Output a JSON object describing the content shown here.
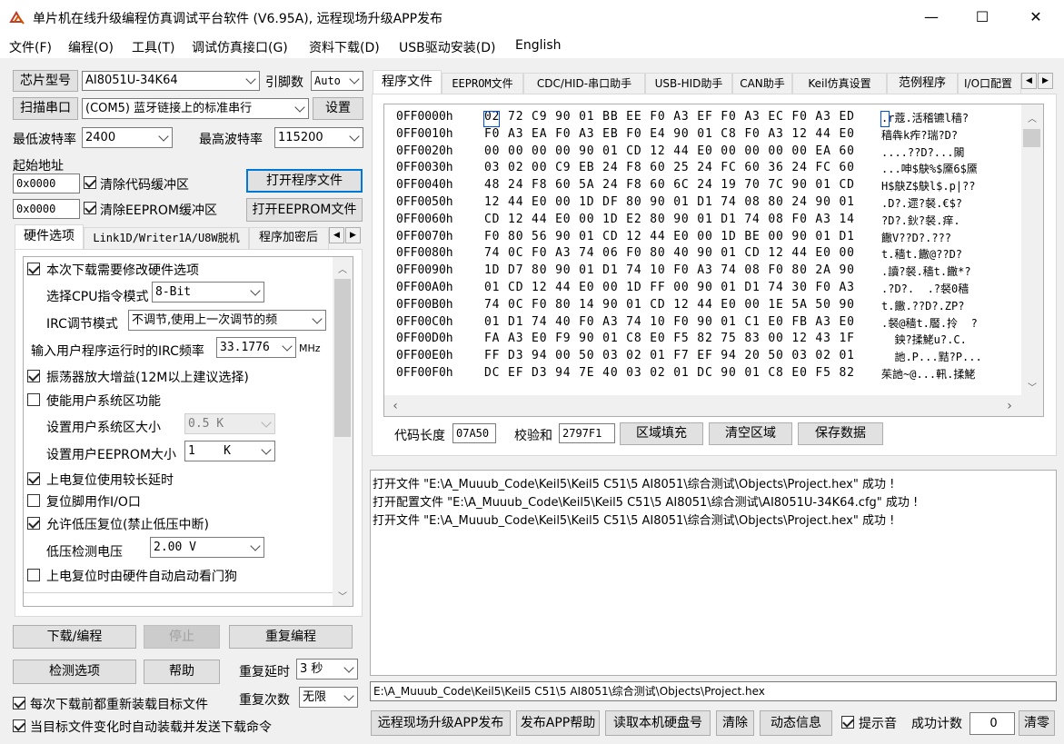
{
  "window": {
    "title": "单片机在线升级编程仿真调试平台软件 (V6.95A), 远程现场升级APP发布",
    "minimize": "—",
    "maximize": "☐",
    "close": "✕"
  },
  "menu": [
    "文件(F)",
    "编程(O)",
    "工具(T)",
    "调试仿真接口(G)",
    "资料下载(D)",
    "USB驱动安装(D)",
    "English"
  ],
  "left": {
    "chip_button": "芯片型号",
    "chip_value": "AI8051U-34K64",
    "pins_label": "引脚数",
    "pins_value": "Auto",
    "scan_button": "扫描串口",
    "port_value": "(COM5) 蓝牙链接上的标准串行",
    "settings_button": "设置",
    "min_baud_label": "最低波特率",
    "min_baud_value": "2400",
    "max_baud_label": "最高波特率",
    "max_baud_value": "115200",
    "start_addr_label": "起始地址",
    "addr1": "0x0000",
    "clear_code_label": "清除代码缓冲区",
    "open_prog_button": "打开程序文件",
    "addr2": "0x0000",
    "clear_eeprom_label": "清除EEPROM缓冲区",
    "open_eeprom_button": "打开EEPROM文件",
    "tabs": [
      "硬件选项",
      "Link1D/Writer1A/U8W脱机",
      "程序加密后"
    ],
    "hw": {
      "modify_hw": "本次下载需要修改硬件选项",
      "cpu_mode_label": "选择CPU指令模式",
      "cpu_mode_value": "8-Bit",
      "irc_label": "IRC调节模式",
      "irc_value": "不调节,使用上一次调节的频",
      "irc_freq_label": "输入用户程序运行时的IRC频率",
      "irc_freq_value": "33.1776",
      "irc_unit": "MHz",
      "osc_gain": "振荡器放大增益(12M以上建议选择)",
      "user_sys": "使能用户系统区功能",
      "user_sys_size_label": "设置用户系统区大小",
      "user_sys_size_value": "0.5 K",
      "user_eeprom_label": "设置用户EEPROM大小",
      "user_eeprom_value": "1    K",
      "long_reset": "上电复位使用较长延时",
      "reset_io": "复位脚用作I/O口",
      "low_volt_reset": "允许低压复位(禁止低压中断)",
      "low_volt_label": "低压检测电压",
      "low_volt_value": "2.00 V",
      "watchdog": "上电复位时由硬件自动启动看门狗"
    },
    "download_button": "下载/编程",
    "stop_button": "停止",
    "reprogram_button": "重复编程",
    "check_button": "检测选项",
    "help_button": "帮助",
    "repeat_delay_label": "重复延时",
    "repeat_delay_value": "3 秒",
    "repeat_count_label": "重复次数",
    "repeat_count_value": "无限",
    "reload_label": "每次下载前都重新装载目标文件",
    "auto_send_label": "当目标文件变化时自动装载并发送下载命令"
  },
  "right": {
    "tabs": [
      "程序文件",
      "EEPROM文件",
      "CDC/HID-串口助手",
      "USB-HID助手",
      "CAN助手",
      "Keil仿真设置",
      "范例程序",
      "I/O口配置"
    ],
    "hex_rows": [
      {
        "addr": "0FF0000h",
        "bytes": "02 72 C9 90 01 BB EE F0 A3 EF F0 A3 EC F0 A3 ED",
        "ascii": ".r蔻.活稽镳l穑?"
      },
      {
        "addr": "0FF0010h",
        "bytes": "F0 A3 EA F0 A3 EB F0 E4 90 01 C8 F0 A3 12 44 E0",
        "ascii": "穑犇k痄?瑞?D?"
      },
      {
        "addr": "0FF0020h",
        "bytes": "00 00 00 00 90 01 CD 12 44 E0 00 00 00 00 EA 60",
        "ascii": "....??D?...闎"
      },
      {
        "addr": "0FF0030h",
        "bytes": "03 02 00 C9 EB 24 F8 60 25 24 FC 60 36 24 FC 60",
        "ascii": "...呻$鴃%$黡6$黡"
      },
      {
        "addr": "0FF0040h",
        "bytes": "48 24 F8 60 5A 24 F8 60 6C 24 19 70 7C 90 01 CD",
        "ascii": "H$鴃Z$鴃l$.p|??"
      },
      {
        "addr": "0FF0050h",
        "bytes": "12 44 E0 00 1D DF 80 90 01 D1 74 08 80 24 90 01",
        "ascii": ".D?.遝?裻.€$?"
      },
      {
        "addr": "0FF0060h",
        "bytes": "CD 12 44 E0 00 1D E2 80 90 01 D1 74 08 F0 A3 14",
        "ascii": "?D?.鈥?裻.痒."
      },
      {
        "addr": "0FF0070h",
        "bytes": "F0 80 56 90 01 CD 12 44 E0 00 1D BE 00 90 01 D1",
        "ascii": "饊V??D?.???"
      },
      {
        "addr": "0FF0080h",
        "bytes": "74 0C F0 A3 74 06 F0 80 40 90 01 CD 12 44 E0 00",
        "ascii": "t.穑t.饊@??D?"
      },
      {
        "addr": "0FF0090h",
        "bytes": "1D D7 80 90 01 D1 74 10 F0 A3 74 08 F0 80 2A 90",
        "ascii": ".讀?裻.穑t.饊*?"
      },
      {
        "addr": "0FF00A0h",
        "bytes": "01 CD 12 44 E0 00 1D FF 00 90 01 D1 74 30 F0 A3",
        "ascii": ".?D?.  .?裻0穑"
      },
      {
        "addr": "0FF00B0h",
        "bytes": "74 0C F0 80 14 90 01 CD 12 44 E0 00 1E 5A 50 90",
        "ascii": "t.饊.??D?.ZP?"
      },
      {
        "addr": "0FF00C0h",
        "bytes": "01 D1 74 40 F0 A3 74 10 F0 90 01 C1 E0 FB A3 E0",
        "ascii": ".裻@穑t.饜.拎  ?"
      },
      {
        "addr": "0FF00D0h",
        "bytes": "FA A3 E0 F9 90 01 C8 E0 F5 82 75 83 00 12 43 1F",
        "ascii": "  鉠?揉鮱u?.C."
      },
      {
        "addr": "0FF00E0h",
        "bytes": "FF D3 94 00 50 03 02 01 F7 EF 94 20 50 03 02 01",
        "ascii": "  訑.P...黠?P..."
      },
      {
        "addr": "0FF00F0h",
        "bytes": "DC EF D3 94 7E 40 03 02 01 DC 90 01 C8 E0 F5 82",
        "ascii": "茱訑~@...軐.揉鮱"
      }
    ],
    "code_len_label": "代码长度",
    "code_len_value": "07A50",
    "checksum_label": "校验和",
    "checksum_value": "2797F1",
    "fill_button": "区域填充",
    "clear_area_button": "清空区域",
    "save_button": "保存数据",
    "log": [
      "打开文件 \"E:\\A_Muuub_Code\\Keil5\\Keil5 C51\\5 AI8051\\综合测试\\Objects\\Project.hex\" 成功 !",
      "打开配置文件 \"E:\\A_Muuub_Code\\Keil5\\Keil5 C51\\5 AI8051\\综合测试\\AI8051U-34K64.cfg\" 成功 !",
      "打开文件 \"E:\\A_Muuub_Code\\Keil5\\Keil5 C51\\5 AI8051\\综合测试\\Objects\\Project.hex\" 成功 !"
    ],
    "path": "E:\\A_Muuub_Code\\Keil5\\Keil5 C51\\5 AI8051\\综合测试\\Objects\\Project.hex",
    "remote_button": "远程现场升级APP发布",
    "publish_help_button": "发布APP帮助",
    "read_disk_button": "读取本机硬盘号",
    "clear_button": "清除",
    "dynamic_button": "动态信息",
    "sound_label": "提示音",
    "success_label": "成功计数",
    "success_value": "0",
    "reset_button": "清零"
  }
}
